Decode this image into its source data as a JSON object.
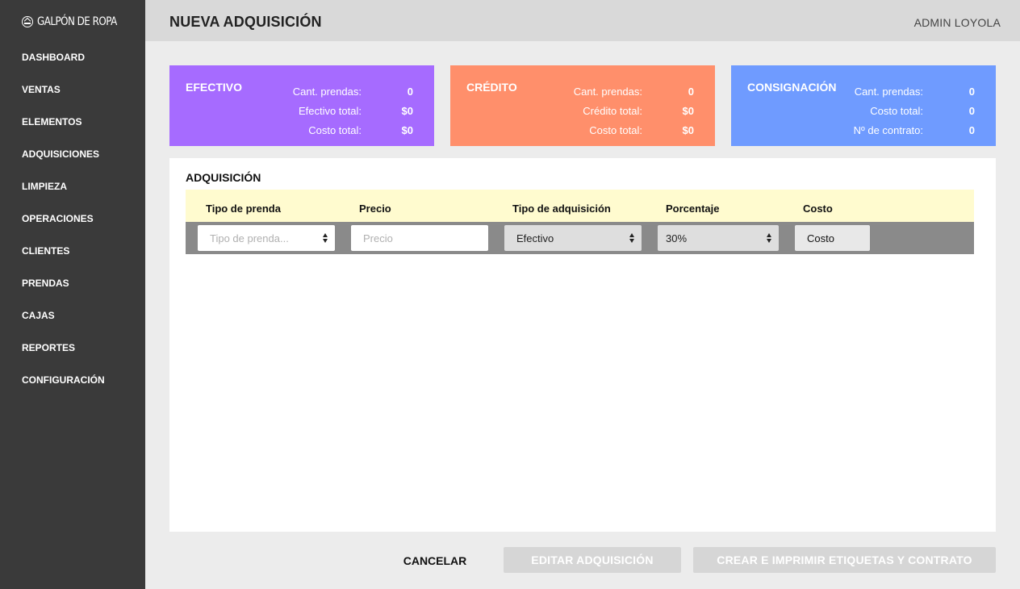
{
  "brand": {
    "name": "GALPÓN DE ROPA",
    "icon": "hanger-icon"
  },
  "sidebar": {
    "items": [
      {
        "label": "DASHBOARD"
      },
      {
        "label": "VENTAS"
      },
      {
        "label": "ELEMENTOS"
      },
      {
        "label": "ADQUISICIONES"
      },
      {
        "label": "LIMPIEZA"
      },
      {
        "label": "OPERACIONES"
      },
      {
        "label": "CLIENTES"
      },
      {
        "label": "PRENDAS"
      },
      {
        "label": "CAJAS"
      },
      {
        "label": "REPORTES"
      },
      {
        "label": "CONFIGURACIÓN"
      }
    ]
  },
  "header": {
    "title": "NUEVA ADQUISICIÓN",
    "user": "ADMIN LOYOLA"
  },
  "cards": {
    "efectivo": {
      "title": "EFECTIVO",
      "color": "#a66bff",
      "rows": [
        {
          "label": "Cant. prendas:",
          "value": "0"
        },
        {
          "label": "Efectivo total:",
          "value": "$0"
        },
        {
          "label": "Costo total:",
          "value": "$0"
        }
      ]
    },
    "credito": {
      "title": "CRÉDITO",
      "color": "#ff8f6b",
      "rows": [
        {
          "label": "Cant. prendas:",
          "value": "0"
        },
        {
          "label": "Crédito total:",
          "value": "$0"
        },
        {
          "label": "Costo total:",
          "value": "$0"
        }
      ]
    },
    "consignacion": {
      "title": "CONSIGNACIÓN",
      "color": "#6f9bff",
      "rows": [
        {
          "label": "Cant. prendas:",
          "value": "0"
        },
        {
          "label": "Costo total:",
          "value": "0"
        },
        {
          "label": "Nº de contrato:",
          "value": "0"
        }
      ]
    }
  },
  "acquisition": {
    "title": "ADQUISICIÓN",
    "columns": [
      "Tipo de prenda",
      "Precio",
      "Tipo de adquisición",
      "Porcentaje",
      "Costo"
    ],
    "row": {
      "tipo_placeholder": "Tipo de prenda...",
      "precio_placeholder": "Precio",
      "tipo_adquisicion": "Efectivo",
      "porcentaje": "30%",
      "costo": "Costo"
    }
  },
  "actions": {
    "cancel": "CANCELAR",
    "edit": "EDITAR ADQUISICIÓN",
    "create": "CREAR E IMPRIMIR ETIQUETAS Y CONTRATO"
  }
}
